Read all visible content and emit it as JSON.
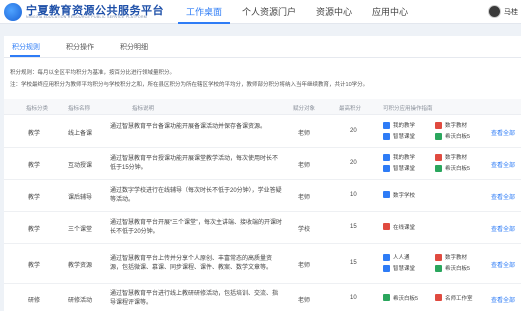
{
  "header": {
    "title": "宁夏教育资源公共服务平台",
    "subtitle": "NINGXIA EDUCATION RESOURCE PUBLIC SERVICE PLATFORM",
    "nav": [
      "工作桌面",
      "个人资源门户",
      "资源中心",
      "应用中心"
    ],
    "user": "马桂"
  },
  "tabs": [
    "积分规则",
    "积分操作",
    "积分明细"
  ],
  "rules": {
    "line1": "积分规则：每月以全区平均积分为基准，按百分比进行领域量积分。",
    "line2": "注：学校最终应用积分为教师平均积分与学校积分之和，所在县区积分为所在辖区学校的平均分，教师部分积分将纳入当年继续教育，共计10学分。"
  },
  "table": {
    "headers": [
      "指标分类",
      "指标名称",
      "指标说明",
      "赋分对象",
      "最高积分",
      "可积分应用操作指南"
    ],
    "view_all": "查看全部",
    "rows": [
      {
        "category": "教学",
        "name": "线上备课",
        "desc": "通过智慧教育平台备课功能开展备课活动并保存备课资源。",
        "target": "老师",
        "max": "20",
        "tools": [
          {
            "name": "我的教学",
            "color": "#2e7cf6"
          },
          {
            "name": "数字教材",
            "color": "#e04a3f"
          },
          {
            "name": "智慧课堂",
            "color": "#2e7cf6"
          },
          {
            "name": "希沃白板5",
            "color": "#2aa65d"
          }
        ]
      },
      {
        "category": "教学",
        "name": "互动授课",
        "desc": "通过智慧教育平台授课功能开展课堂教学活动，每次使用时长不低于15分钟。",
        "target": "老师",
        "max": "20",
        "tools": [
          {
            "name": "我的教学",
            "color": "#2e7cf6"
          },
          {
            "name": "数字教材",
            "color": "#e04a3f"
          },
          {
            "name": "智慧课堂",
            "color": "#2e7cf6"
          },
          {
            "name": "希沃白板5",
            "color": "#2aa65d"
          }
        ]
      },
      {
        "category": "教学",
        "name": "课后辅导",
        "desc": "通过数字学校进行在线辅导（每次时长不低于20分钟），学业答疑等活动。",
        "target": "老师",
        "max": "10",
        "tools": [
          {
            "name": "数字学校",
            "color": "#2e7cf6"
          }
        ]
      },
      {
        "category": "教学",
        "name": "三个课堂",
        "desc": "通过智慧教育平台开展“三个课堂”，每次主讲端、接收端的开课时长不低于20分钟。",
        "target": "学校",
        "max": "15",
        "tools": [
          {
            "name": "在线课堂",
            "color": "#e04a3f"
          }
        ]
      },
      {
        "category": "教学",
        "name": "教学资源",
        "desc": "通过智慧教育平台上传并分享个人原创、丰富常态的高质量资源，包括微课、慕课、同步课程、课件、教案、数学文章等。",
        "target": "老师",
        "max": "15",
        "tools": [
          {
            "name": "人人通",
            "color": "#2e7cf6"
          },
          {
            "name": "数字教材",
            "color": "#e04a3f"
          },
          {
            "name": "智慧课堂",
            "color": "#2e7cf6"
          },
          {
            "name": "希沃白板5",
            "color": "#2aa65d"
          }
        ]
      },
      {
        "category": "研修",
        "name": "研修活动",
        "desc": "通过智慧教育平台进行线上教研研修活动，包括培训、交流、指导课程评课等。",
        "target": "老师",
        "max": "10",
        "tools": [
          {
            "name": "希沃白板5",
            "color": "#2aa65d"
          },
          {
            "name": "名师工作室",
            "color": "#e04a3f"
          }
        ]
      }
    ]
  }
}
